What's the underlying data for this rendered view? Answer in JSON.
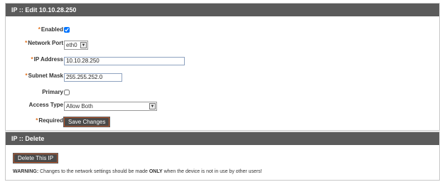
{
  "edit_panel": {
    "title": "IP :: Edit 10.10.28.250",
    "fields": {
      "enabled": {
        "label": "Enabled",
        "required_marker": "*",
        "checked": true
      },
      "network_port": {
        "label": "Network Port",
        "required_marker": "*",
        "value": "eth0"
      },
      "ip_address": {
        "label": "IP Address",
        "required_marker": "*",
        "value": "10.10.28.250"
      },
      "subnet_mask": {
        "label": "Subnet Mask",
        "required_marker": "*",
        "value": "255.255.252.0"
      },
      "primary": {
        "label": "Primary",
        "checked": false
      },
      "access_type": {
        "label": "Access Type",
        "value": "Allow Both"
      }
    },
    "required_note": {
      "marker": "*",
      "label": "Required"
    },
    "save_button": "Save Changes"
  },
  "delete_panel": {
    "title": "IP :: Delete",
    "delete_button": "Delete This IP",
    "warning": {
      "prefix": "WARNING:",
      "text_before": " Changes to the network settings should be made ",
      "emphasis": "ONLY",
      "text_after": " when the device is not in use by other users!"
    }
  },
  "colors": {
    "header_bg": "#5b5b5b",
    "required_marker": "#e0701c",
    "button_bg": "#4a4a4a",
    "button_border": "#b5532a"
  },
  "icons": {
    "dropdown": "chevron-down-icon"
  }
}
